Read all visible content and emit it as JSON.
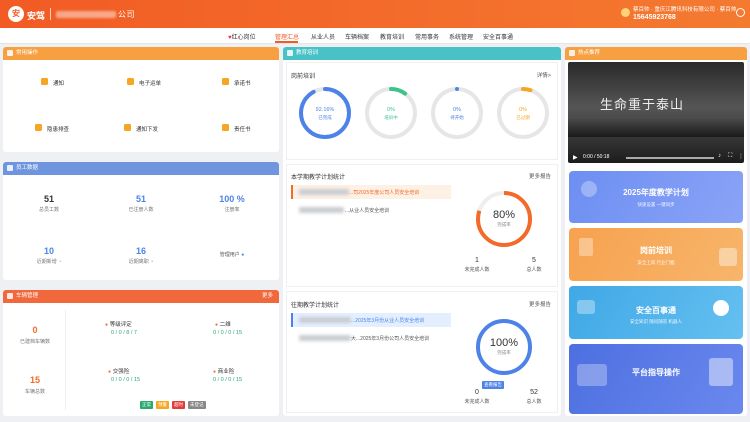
{
  "header": {
    "brand": "安驾",
    "company_suffix": "公司",
    "user_line": "蔡百帅 · 重庆江腾讯科技有限公司 · 蔡百帅",
    "phone": "15645923768"
  },
  "nav": [
    {
      "label": "红心岗位",
      "icon": "heart-icon"
    },
    {
      "label": "管理汇总",
      "active": true
    },
    {
      "label": "从业人员"
    },
    {
      "label": "车辆档案"
    },
    {
      "label": "教育培训"
    },
    {
      "label": "常用事务"
    },
    {
      "label": "系统管理"
    },
    {
      "label": "安全百事通"
    }
  ],
  "common_ops": {
    "title": "常用操作",
    "items": [
      {
        "label": "通知",
        "icon": "bell-icon",
        "color": "#f5a623"
      },
      {
        "label": "电子运单",
        "icon": "document-icon",
        "color": "#f5a623"
      },
      {
        "label": "承诺书",
        "icon": "pledge-icon",
        "color": "#f5a623"
      },
      {
        "label": "隐患排查",
        "icon": "hazard-icon",
        "color": "#f5a623"
      },
      {
        "label": "通知下发",
        "icon": "send-icon",
        "color": "#f5a623"
      },
      {
        "label": "责任书",
        "icon": "responsibility-icon",
        "color": "#f5a623"
      }
    ]
  },
  "staff": {
    "title": "员工数据",
    "stats": [
      {
        "value": "51",
        "label": "总员工数"
      },
      {
        "value": "51",
        "label": "已注册人数"
      },
      {
        "value": "100 %",
        "label": "注册率"
      },
      {
        "value": "10",
        "label": "近期新增"
      },
      {
        "value": "16",
        "label": "近期离职"
      },
      {
        "value": "",
        "label": "管理用户"
      }
    ]
  },
  "vehicle": {
    "title": "车辆管理",
    "more": "更多",
    "left": [
      {
        "value": "0",
        "label": "已建档车辆数"
      },
      {
        "value": "15",
        "label": "车辆总数"
      }
    ],
    "items": [
      {
        "label": "等级评定",
        "values": "0 / 0 / 8 / 7"
      },
      {
        "label": "二维",
        "values": "0 / 0 / 0 / 15"
      },
      {
        "label": "交强险",
        "values": "0 / 0 / 0 / 15"
      },
      {
        "label": "商业险",
        "values": "0 / 0 / 0 / 15"
      }
    ],
    "legend": [
      {
        "label": "正常",
        "color": "#2aa86e"
      },
      {
        "label": "预警",
        "color": "#f5a623"
      },
      {
        "label": "超时",
        "color": "#e23b3b"
      },
      {
        "label": "未登记",
        "color": "#888888"
      }
    ]
  },
  "education": {
    "title": "教育培训",
    "pre_job": {
      "title": "岗前培训",
      "more": "详情>",
      "rings": [
        {
          "value": "92.16%",
          "label": "已完成",
          "progress": 0.92,
          "color": "#4d83e8"
        },
        {
          "value": "0%",
          "label": "培训中",
          "progress": 0.1,
          "color": "#3cc48a"
        },
        {
          "value": "0%",
          "label": "待开始",
          "progress": 0,
          "color": "#4d83e8"
        },
        {
          "value": "0%",
          "label": "已过期",
          "progress": 0.05,
          "color": "#f5a623"
        }
      ]
    },
    "current": {
      "title": "本学期教学计划统计",
      "more": "更多报告",
      "lines": [
        "...司2025年度公司人员安全培训",
        "...从业人员安全培训"
      ],
      "percent": "80%",
      "percent_label": "完成率",
      "progress": 0.8,
      "color": "#f26b2a",
      "stats": [
        {
          "value": "1",
          "label": "未完成人数"
        },
        {
          "value": "5",
          "label": "总人数"
        }
      ]
    },
    "past": {
      "title": "往期教学计划统计",
      "more": "更多报告",
      "lines": [
        "...2025年3月份从业人员安全培训",
        "大...2025年3月份公司人员安全培训"
      ],
      "percent": "100%",
      "percent_label": "完成率",
      "progress": 1.0,
      "color": "#4d83e8",
      "badge": "查看报告",
      "stats": [
        {
          "value": "0",
          "label": "未完成人数"
        },
        {
          "value": "52",
          "label": "总人数"
        }
      ]
    }
  },
  "hot": {
    "title": "热点推荐",
    "video_caption": "生命重于泰山",
    "video_time": "0:00 / 50:18",
    "banners": [
      {
        "title": "2025年度教学计划",
        "sub": "快速设置 一键同步"
      },
      {
        "title": "岗前培训",
        "sub": "安全上岗 行业门槛"
      },
      {
        "title": "安全百事通",
        "sub": "安全知识 随问随答 机器人"
      },
      {
        "title": "平台指导操作",
        "sub": ""
      }
    ]
  }
}
